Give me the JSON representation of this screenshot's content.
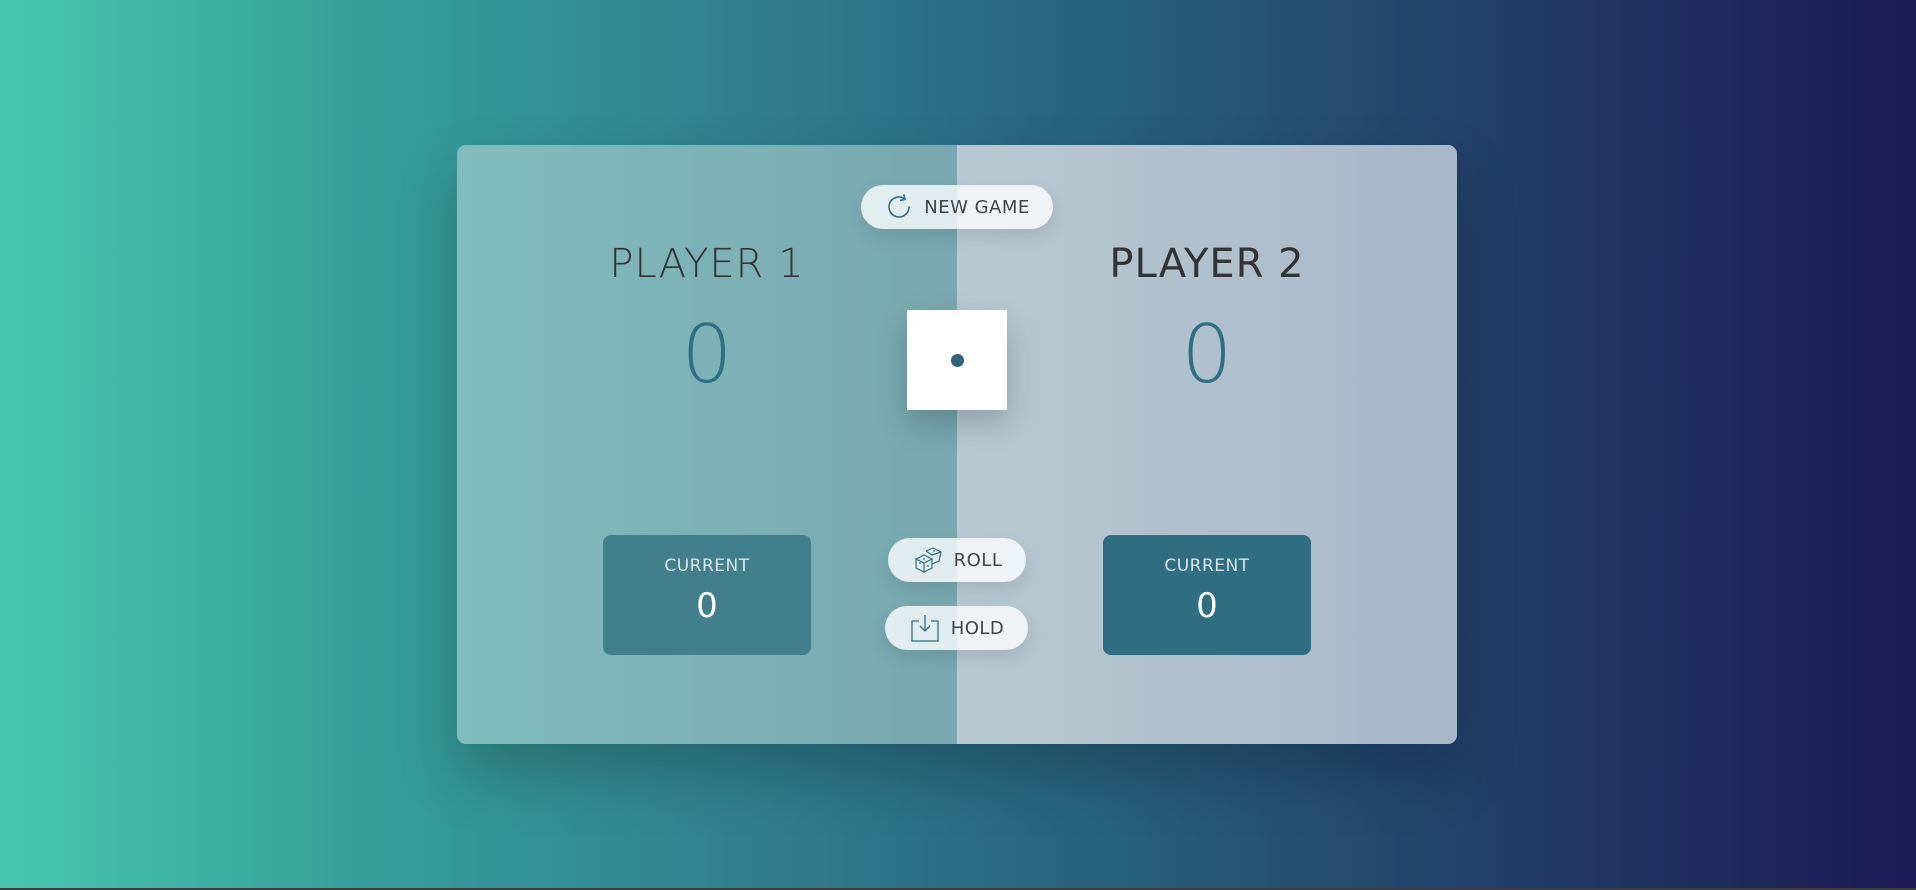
{
  "players": [
    {
      "name": "PLAYER 1",
      "score": "0",
      "current_label": "CURRENT",
      "current": "0"
    },
    {
      "name": "PLAYER 2",
      "score": "0",
      "current_label": "CURRENT",
      "current": "0"
    }
  ],
  "controls": {
    "new_game": "NEW GAME",
    "roll": "ROLL",
    "hold": "HOLD"
  },
  "dice": {
    "value": 1
  },
  "colors": {
    "accent": "#2f6f85",
    "bg_start": "#47c8ae",
    "bg_end": "#1d1a55"
  },
  "icons": {
    "new_game": "refresh-icon",
    "roll": "dice-icon",
    "hold": "download-tray-icon"
  }
}
